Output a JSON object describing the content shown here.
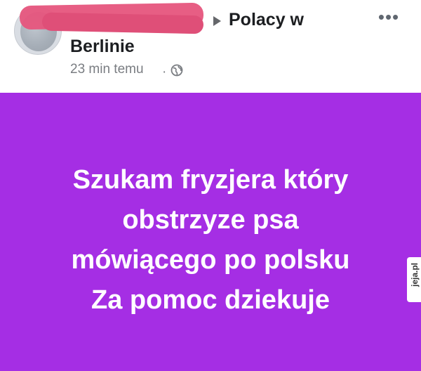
{
  "header": {
    "group_name_line1": "Polacy w",
    "group_name_line2": "Berlinie",
    "timestamp": "23 min temu",
    "separator": "·",
    "more_icon": "more-horizontal-icon",
    "privacy_icon": "globe-icon"
  },
  "post": {
    "text": "Szukam fryzjera który\nobstrzyze psa\nmówiącego po polsku\nZa pomoc dziekuje",
    "background_color": "#a52ee4"
  },
  "watermark": {
    "text": "jeja.pl"
  }
}
